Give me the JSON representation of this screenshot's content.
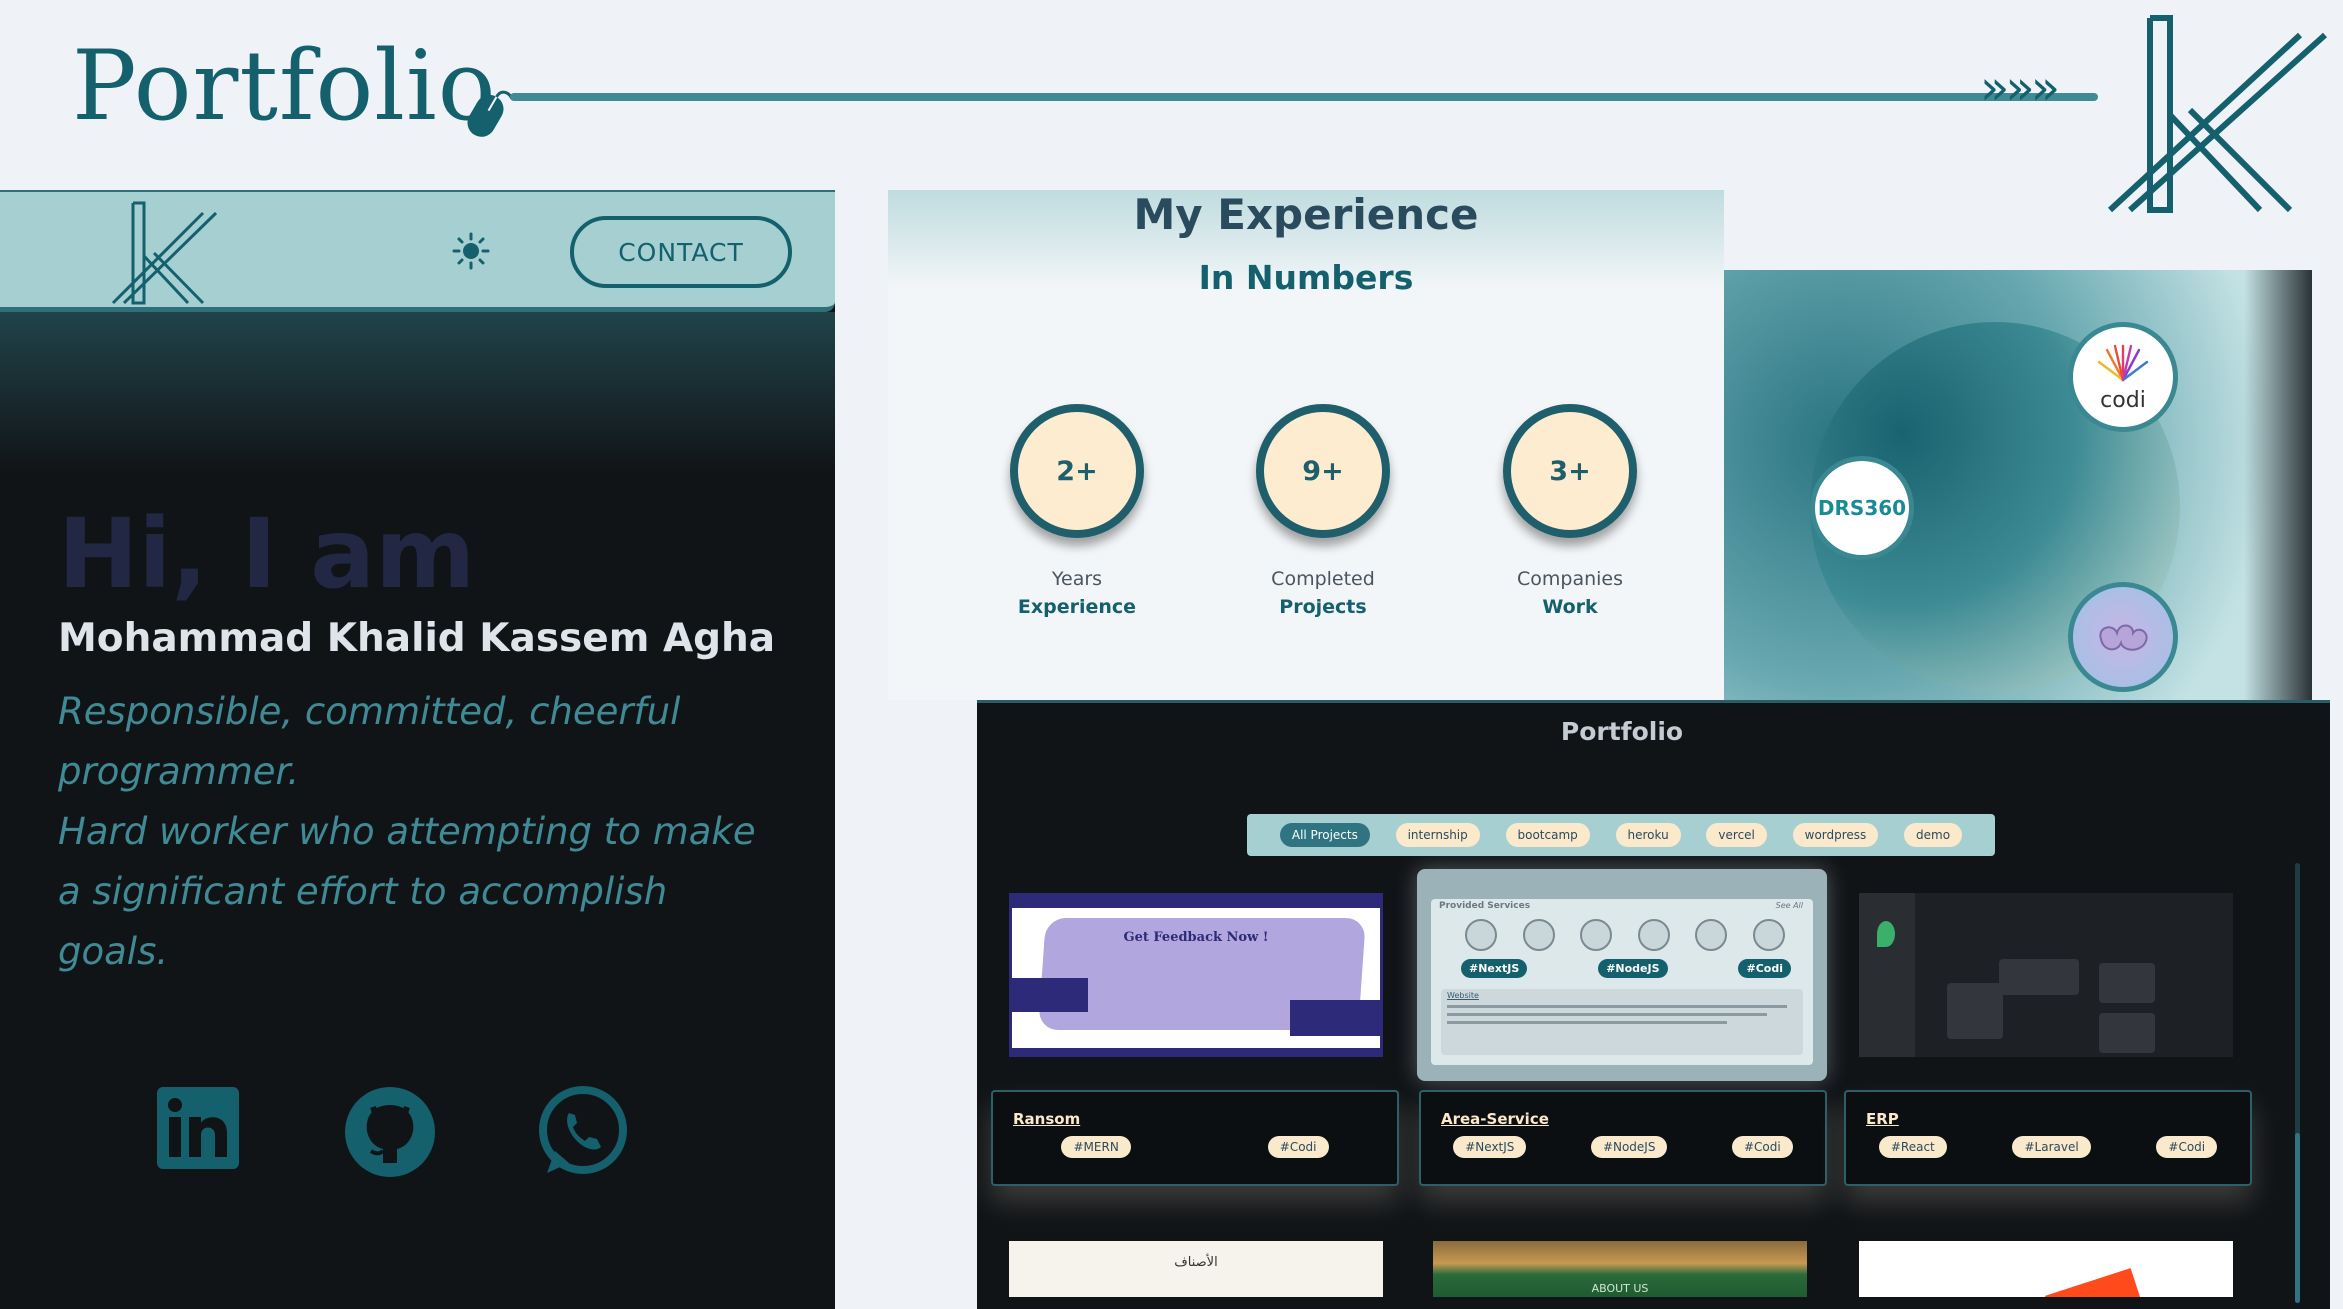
{
  "header": {
    "title": "Portfolio",
    "arrows": "»»»"
  },
  "hero": {
    "contact_label": "CONTACT",
    "greeting": "Hi, I am",
    "name": "Mohammad Khalid Kassem Agha",
    "tagline_1": "Responsible, committed, cheerful programmer.",
    "tagline_2": "Hard worker who attempting to make a significant effort to accomplish goals.",
    "socials": [
      "linkedin-icon",
      "github-icon",
      "whatsapp-icon"
    ]
  },
  "experience": {
    "title": "My Experience",
    "subtitle": "In Numbers",
    "stats": [
      {
        "value": "2+",
        "label": "Years",
        "strong": "Experience"
      },
      {
        "value": "9+",
        "label": "Completed",
        "strong": "Projects"
      },
      {
        "value": "3+",
        "label": "Companies",
        "strong": "Work"
      }
    ]
  },
  "companies": {
    "codi": "codi",
    "drs": "DRS360"
  },
  "portfolio": {
    "title": "Portfolio",
    "filters": [
      "All Projects",
      "internship",
      "bootcamp",
      "heroku",
      "vercel",
      "wordpress",
      "demo"
    ],
    "active_filter": "All Projects",
    "ransom_preview": {
      "heading": "Get Feedback Now !"
    },
    "area_preview": {
      "heading": "Provided Services",
      "see_all": "See All",
      "tags": [
        "#NextJS",
        "#NodeJS",
        "#Codi"
      ],
      "link": "Website"
    },
    "projects": [
      {
        "title": "Ransom",
        "tags": [
          "#MERN",
          "#Codi"
        ]
      },
      {
        "title": "Area-Service",
        "tags": [
          "#NextJS",
          "#NodeJS",
          "#Codi"
        ]
      },
      {
        "title": "ERP",
        "tags": [
          "#React",
          "#Laravel",
          "#Codi"
        ]
      }
    ],
    "bottom_preview_1": "الأصناف",
    "bottom_preview_2": "ABOUT US"
  },
  "colors": {
    "primary": "#14606d",
    "accent": "#3f8a95",
    "cream": "#fbe9cc",
    "dark": "#111417"
  }
}
